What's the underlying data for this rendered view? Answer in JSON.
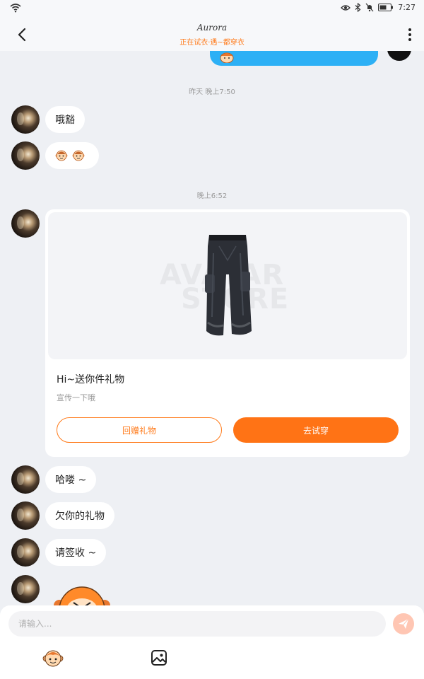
{
  "status_bar": {
    "time": "7:27",
    "icons": [
      "wifi-icon",
      "eye-icon",
      "bluetooth-icon",
      "mute-icon",
      "battery-icon"
    ]
  },
  "header": {
    "title": "Aurora",
    "subtitle": "正在试衣·遇~都穿衣",
    "icons": [
      "back-arrow-icon",
      "more-vertical-icon"
    ]
  },
  "chat": {
    "timestamps": [
      "昨天 晚上7:50",
      "晚上6:52"
    ],
    "messages_before": [
      {
        "text": "哦豁"
      }
    ],
    "gift_card": {
      "watermark": [
        "AVATAR",
        "STORE"
      ],
      "title": "Hi~送你件礼物",
      "description": "宣传一下哦",
      "return_button": "回赠礼物",
      "try_button": "去试穿"
    },
    "messages_after": [
      {
        "text": "哈喽 ~"
      },
      {
        "text": "欠你的礼物"
      },
      {
        "text": "请签收 ~"
      }
    ]
  },
  "composer": {
    "placeholder": "请输入...",
    "icons": [
      "send-icon",
      "sticker-icon",
      "image-icon"
    ]
  },
  "colors": {
    "accent": "#ff7315",
    "sent_bubble": "#2db0f5",
    "background": "#eef0f4",
    "send_button": "#ffc6b3"
  }
}
